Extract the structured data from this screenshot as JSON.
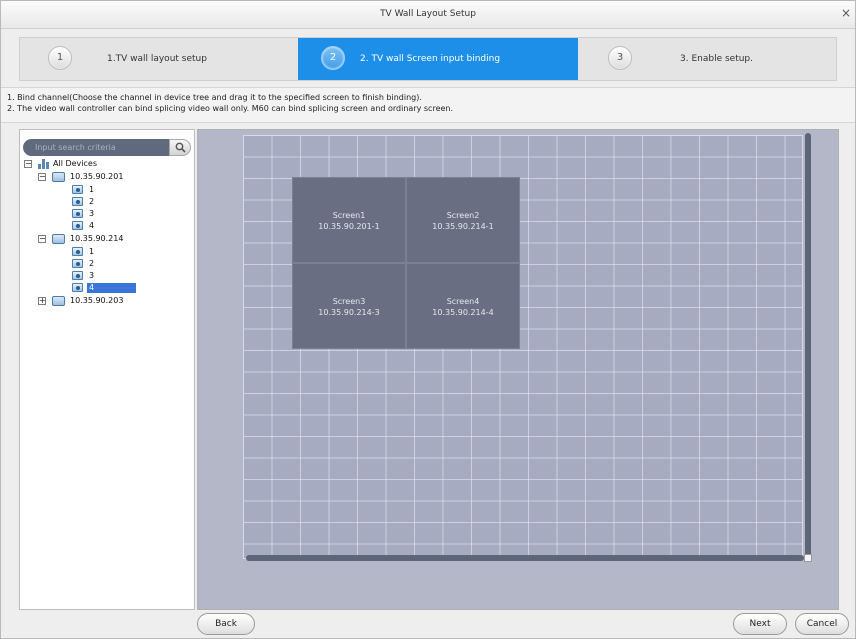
{
  "window": {
    "title": "TV Wall Layout Setup",
    "close_glyph": "×"
  },
  "steps": [
    {
      "number": "1",
      "label": "1.TV wall layout setup",
      "active": false
    },
    {
      "number": "2",
      "label": "2. TV wall Screen input binding",
      "active": true
    },
    {
      "number": "3",
      "label": "3. Enable setup.",
      "active": false
    }
  ],
  "instructions": [
    "1. Bind channel(Choose the channel in device tree and drag it to the specified screen to finish binding).",
    "2. The video wall controller can bind splicing video wall only.  M60 can bind splicing screen and ordinary screen."
  ],
  "search": {
    "placeholder": "Input search criteria",
    "icon": "search-icon"
  },
  "tree": {
    "root": "All Devices",
    "devices": [
      {
        "ip": "10.35.90.201",
        "expanded": true,
        "channels": [
          "1",
          "2",
          "3",
          "4"
        ]
      },
      {
        "ip": "10.35.90.214",
        "expanded": true,
        "channels": [
          "1",
          "2",
          "3",
          "4"
        ],
        "selected_channel": "4"
      },
      {
        "ip": "10.35.90.203",
        "expanded": false,
        "channels": []
      }
    ],
    "collapse_glyph": "−",
    "expand_glyph": "+"
  },
  "screens": [
    {
      "name": "Screen1",
      "binding": "10.35.90.201-1"
    },
    {
      "name": "Screen2",
      "binding": "10.35.90.214-1"
    },
    {
      "name": "Screen3",
      "binding": "10.35.90.214-3"
    },
    {
      "name": "Screen4",
      "binding": "10.35.90.214-4"
    }
  ],
  "buttons": {
    "back": "Back",
    "next": "Next",
    "cancel": "Cancel"
  }
}
